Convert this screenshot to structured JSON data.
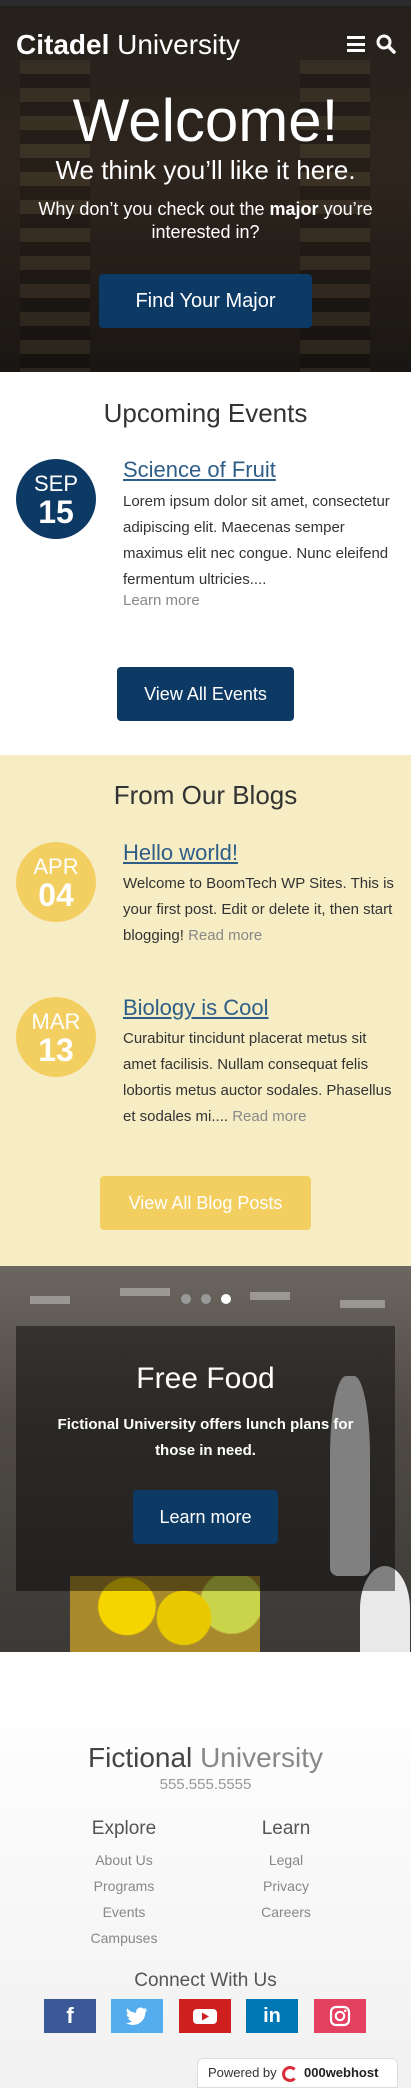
{
  "header": {
    "logo_bold": "Citadel",
    "logo_light": "University"
  },
  "hero": {
    "welcome": "Welcome!",
    "subtitle": "We think you’ll like it here.",
    "prompt_before": "Why don’t you check out the ",
    "prompt_bold": "major",
    "prompt_after": " you’re interested in?",
    "cta": "Find Your Major"
  },
  "events": {
    "title": "Upcoming Events",
    "items": [
      {
        "month": "SEP",
        "day": "15",
        "title": "Science of Fruit",
        "excerpt": "Lorem ipsum dolor sit amet, consectetur adipiscing elit. Maecenas semper maximus elit nec congue. Nunc eleifend fermentum ultricies....",
        "more": "Learn more"
      }
    ],
    "button": "View All Events"
  },
  "blogs": {
    "title": "From Our Blogs",
    "items": [
      {
        "month": "APR",
        "day": "04",
        "title": "Hello world!",
        "excerpt": "Welcome to BoomTech WP Sites. This is your first post. Edit or delete it, then start blogging!",
        "more": "Read more"
      },
      {
        "month": "MAR",
        "day": "13",
        "title": "Biology is Cool",
        "excerpt": "Curabitur tincidunt placerat metus sit amet facilisis. Nullam consequat felis lobortis metus auctor sodales. Phasellus et sodales mi....",
        "more": "Read more"
      }
    ],
    "button": "View All Blog Posts"
  },
  "slider": {
    "title": "Free Food",
    "text": "Fictional University offers lunch plans for those in need.",
    "button": "Learn more",
    "slide_count": 3,
    "active_slide": 3
  },
  "footer": {
    "logo_bold": "Fictional",
    "logo_light": "University",
    "phone": "555.555.5555",
    "explore": {
      "heading": "Explore",
      "links": [
        "About Us",
        "Programs",
        "Events",
        "Campuses"
      ]
    },
    "learn": {
      "heading": "Learn",
      "links": [
        "Legal",
        "Privacy",
        "Careers"
      ]
    },
    "connect": "Connect With Us",
    "social": [
      {
        "icon": "facebook-icon",
        "glyph": "f",
        "color": "#3b5998"
      },
      {
        "icon": "twitter-icon",
        "glyph": "🐦",
        "color": "#55acee"
      },
      {
        "icon": "youtube-icon",
        "glyph": "▶",
        "color": "#cd201f"
      },
      {
        "icon": "linkedin-icon",
        "glyph": "in",
        "color": "#0077b5"
      },
      {
        "icon": "instagram-icon",
        "glyph": "◎",
        "color": "#e4405f"
      }
    ]
  },
  "powered_by": {
    "label": "Powered by",
    "brand": "000webhost"
  },
  "colors": {
    "primary_blue": "#0d3965",
    "blog_yellow": "#f3cf62",
    "blog_bg": "#f7edc4"
  }
}
